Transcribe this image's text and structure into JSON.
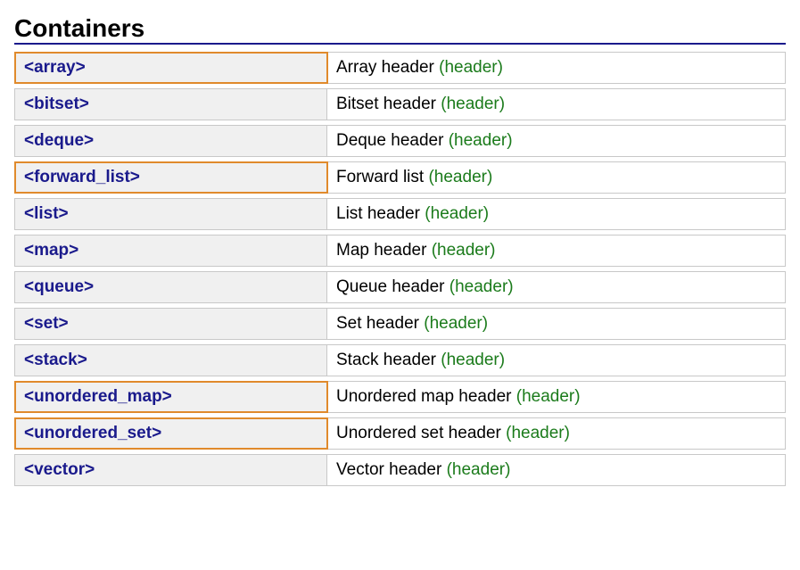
{
  "heading": "Containers",
  "tag_label": "(header)",
  "rows": [
    {
      "link": "<array>",
      "desc": "Array header",
      "highlighted": true
    },
    {
      "link": "<bitset>",
      "desc": "Bitset header",
      "highlighted": false
    },
    {
      "link": "<deque>",
      "desc": "Deque header",
      "highlighted": false
    },
    {
      "link": "<forward_list>",
      "desc": "Forward list",
      "highlighted": true
    },
    {
      "link": "<list>",
      "desc": "List header",
      "highlighted": false
    },
    {
      "link": "<map>",
      "desc": "Map header",
      "highlighted": false
    },
    {
      "link": "<queue>",
      "desc": "Queue header",
      "highlighted": false
    },
    {
      "link": "<set>",
      "desc": "Set header",
      "highlighted": false
    },
    {
      "link": "<stack>",
      "desc": "Stack header",
      "highlighted": false
    },
    {
      "link": "<unordered_map>",
      "desc": "Unordered map header",
      "highlighted": true
    },
    {
      "link": "<unordered_set>",
      "desc": "Unordered set header",
      "highlighted": true
    },
    {
      "link": "<vector>",
      "desc": "Vector header",
      "highlighted": false
    }
  ]
}
